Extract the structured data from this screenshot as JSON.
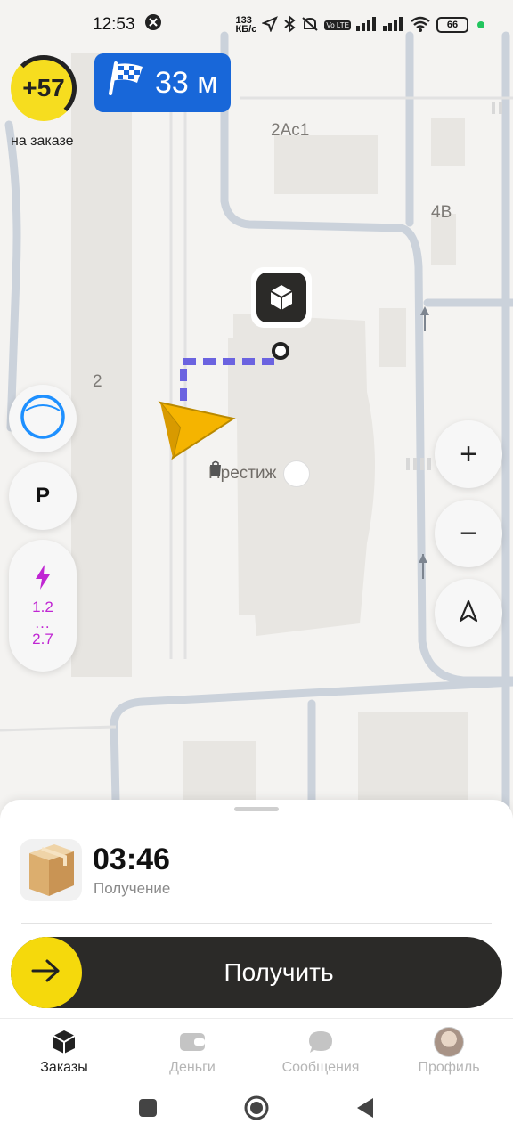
{
  "status_bar": {
    "time": "12:53",
    "net_speed_top": "133",
    "net_speed_bottom": "КБ/с",
    "volte": "Vo LTE",
    "battery": "66",
    "icons": [
      "ya-status-icon",
      "location-icon",
      "bluetooth-icon",
      "mute-icon",
      "volte-icon",
      "signal-icon",
      "signal-icon",
      "wifi-icon",
      "battery-icon"
    ]
  },
  "map": {
    "labels": {
      "building_2ac1": "2Ac1",
      "building_4b": "4B",
      "building_2": "2"
    },
    "poi": {
      "name": "Престиж",
      "icon": "shopping-bag-icon"
    },
    "route_color": "#6b63e0",
    "marker_color": "#f5b400"
  },
  "score": {
    "value": "+57",
    "caption": "на заказе"
  },
  "distance": {
    "value": "33 м",
    "icon": "finish-flag-icon"
  },
  "left_controls": {
    "parking_label": "P",
    "charge_min": "1.2",
    "charge_dots": "...",
    "charge_max": "2.7"
  },
  "right_controls": {
    "zoom_in": "+",
    "zoom_out": "−"
  },
  "order": {
    "timer": "03:46",
    "status": "Получение",
    "action_label": "Получить"
  },
  "tabs": [
    {
      "label": "Заказы",
      "icon": "orders-box-icon",
      "active": true
    },
    {
      "label": "Деньги",
      "icon": "wallet-icon",
      "active": false
    },
    {
      "label": "Сообщения",
      "icon": "chat-icon",
      "active": false
    },
    {
      "label": "Профиль",
      "icon": "avatar",
      "active": false
    }
  ],
  "colors": {
    "accent_yellow": "#f5d90c",
    "distance_blue": "#1867d9",
    "dark_button": "#2b2a28",
    "charge_purple": "#c026d3"
  }
}
